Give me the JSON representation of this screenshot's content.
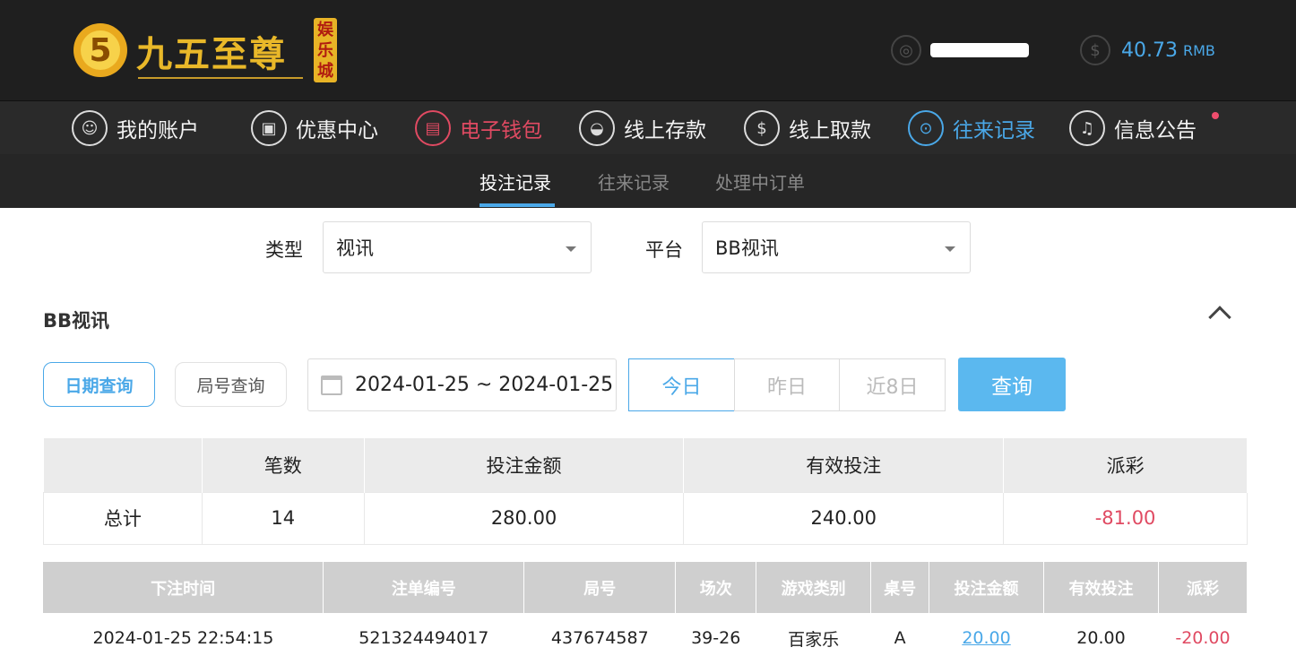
{
  "brand": {
    "name": "九五至尊",
    "tag": "娱乐城",
    "badge_char": "5"
  },
  "account": {
    "user_icon": "user-coin-icon",
    "balance_icon": "dollar-icon",
    "balance_value": "40.73",
    "balance_unit": "RMB"
  },
  "nav": {
    "items": [
      {
        "label": "我的账户",
        "icon": "user-icon"
      },
      {
        "label": "优惠中心",
        "icon": "gift-icon"
      },
      {
        "label": "电子钱包",
        "icon": "wallet-icon"
      },
      {
        "label": "线上存款",
        "icon": "deposit-icon"
      },
      {
        "label": "线上取款",
        "icon": "withdraw-icon"
      },
      {
        "label": "往来记录",
        "icon": "record-icon"
      },
      {
        "label": "信息公告",
        "icon": "bell-icon"
      }
    ]
  },
  "subnav": {
    "tabs": [
      "投注记录",
      "往来记录",
      "处理中订单"
    ]
  },
  "filters": {
    "type_label": "类型",
    "type_value": "视讯",
    "platform_label": "平台",
    "platform_value": "BB视讯"
  },
  "section": {
    "title": "BB视讯"
  },
  "query": {
    "date_mode": "日期查询",
    "round_mode": "局号查询",
    "date_range": "2024-01-25 ~ 2024-01-25",
    "quick": [
      "今日",
      "昨日",
      "近8日"
    ],
    "submit": "查询"
  },
  "summary": {
    "headers": [
      "",
      "笔数",
      "投注金额",
      "有效投注",
      "派彩"
    ],
    "row": [
      "总计",
      "14",
      "280.00",
      "240.00",
      "-81.00"
    ]
  },
  "detail": {
    "headers": [
      "下注时间",
      "注单编号",
      "局号",
      "场次",
      "游戏类别",
      "桌号",
      "投注金额",
      "有效投注",
      "派彩"
    ],
    "rows": [
      [
        "2024-01-25 22:54:15",
        "521324494017",
        "437674587",
        "39-26",
        "百家乐",
        "A",
        "20.00",
        "20.00",
        "-20.00"
      ]
    ]
  },
  "colors": {
    "accent": "#4aa8e8",
    "negative": "#e04a62",
    "header_bg": "#1f1f1f"
  }
}
